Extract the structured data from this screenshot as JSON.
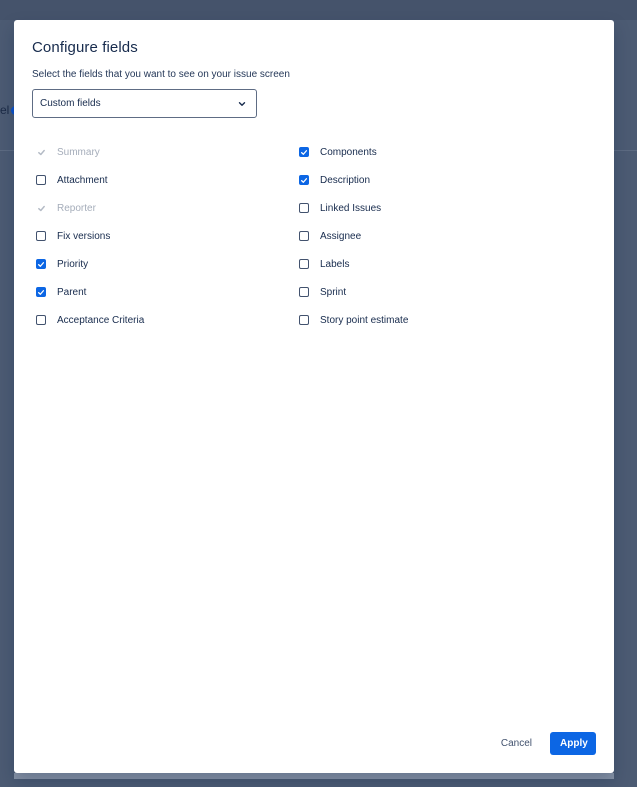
{
  "background": {
    "hint_text": "el"
  },
  "modal": {
    "title": "Configure fields",
    "subtitle": "Select the fields that you want to see on your issue screen",
    "select": {
      "value": "Custom fields",
      "icon": "chevron-down-icon"
    },
    "left_fields": [
      {
        "label": "Summary",
        "checked": true,
        "disabled": true
      },
      {
        "label": "Attachment",
        "checked": false,
        "disabled": false
      },
      {
        "label": "Reporter",
        "checked": true,
        "disabled": true
      },
      {
        "label": "Fix versions",
        "checked": false,
        "disabled": false
      },
      {
        "label": "Priority",
        "checked": true,
        "disabled": false
      },
      {
        "label": "Parent",
        "checked": true,
        "disabled": false
      },
      {
        "label": "Acceptance Criteria",
        "checked": false,
        "disabled": false
      }
    ],
    "right_fields": [
      {
        "label": "Components",
        "checked": true,
        "disabled": false
      },
      {
        "label": "Description",
        "checked": true,
        "disabled": false
      },
      {
        "label": "Linked Issues",
        "checked": false,
        "disabled": false
      },
      {
        "label": "Assignee",
        "checked": false,
        "disabled": false
      },
      {
        "label": "Labels",
        "checked": false,
        "disabled": false
      },
      {
        "label": "Sprint",
        "checked": false,
        "disabled": false
      },
      {
        "label": "Story point estimate",
        "checked": false,
        "disabled": false
      }
    ],
    "footer": {
      "cancel_label": "Cancel",
      "apply_label": "Apply"
    }
  },
  "colors": {
    "accent": "#0c66e4",
    "overlay": "#4c5b73",
    "text": "#172b4d",
    "disabled_text": "#a5adba"
  }
}
